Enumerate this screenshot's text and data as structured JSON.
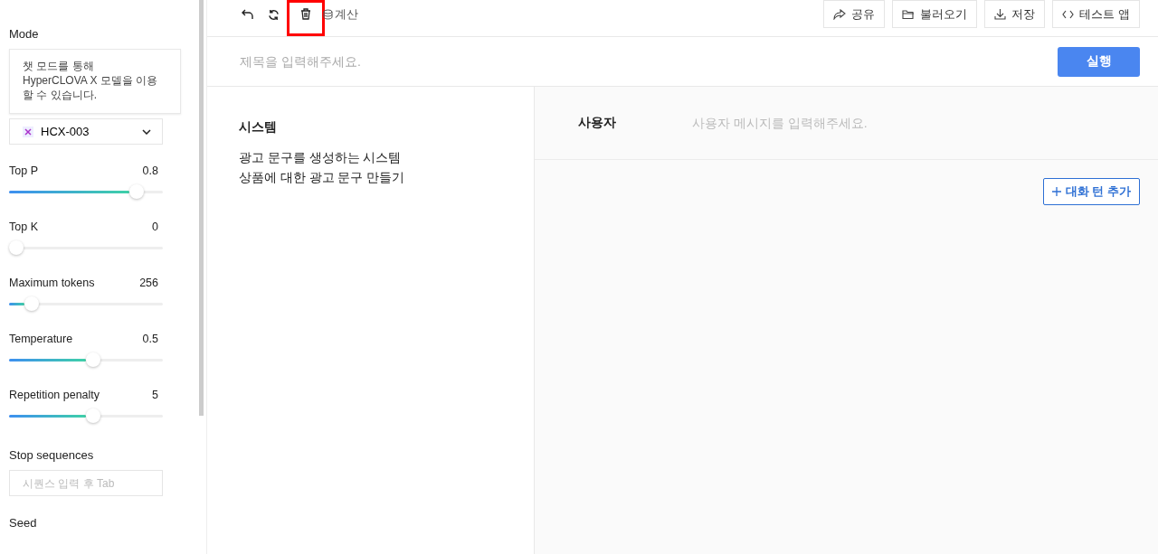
{
  "sidebar": {
    "mode_label": "Mode",
    "mode_description": "챗 모드를 통해 HyperCLOVA X 모델을 이용할 수 있습니다.",
    "model": "HCX-003",
    "params": [
      {
        "label": "Top P",
        "reading": "0.8",
        "level": 0.78
      },
      {
        "label": "Top K",
        "reading": "0",
        "level": 0
      },
      {
        "label": "Maximum tokens",
        "reading": "256",
        "level": 0.1
      },
      {
        "label": "Temperature",
        "reading": "0.5",
        "level": 0.5
      },
      {
        "label": "Repetition penalty",
        "reading": "5",
        "level": 0.5
      }
    ],
    "stop_label": "Stop sequences",
    "stop_placeholder": "시퀀스 입력 후 Tab",
    "seed_label": "Seed"
  },
  "toolbar": {
    "tools": [
      {
        "kind": "undo",
        "highlighted": false
      },
      {
        "kind": "refresh",
        "highlighted": false
      },
      {
        "kind": "trash",
        "highlighted": true
      }
    ],
    "calc": "계산",
    "actions": [
      {
        "kind": "share",
        "label": "공유"
      },
      {
        "kind": "folder",
        "label": "불러오기"
      },
      {
        "kind": "download",
        "label": "저장"
      },
      {
        "kind": "code",
        "label": "테스트 앱"
      }
    ]
  },
  "title_placeholder": "제목을 입력해주세요.",
  "run_button": "실행",
  "system": {
    "heading": "시스템",
    "lines": [
      "광고 문구를 생성하는 시스템",
      "상품에 대한 광고 문구 만들기"
    ]
  },
  "user": {
    "heading": "사용자",
    "placeholder": "사용자 메시지를 입력해주세요."
  },
  "add_turn": "대화 턴 추가"
}
